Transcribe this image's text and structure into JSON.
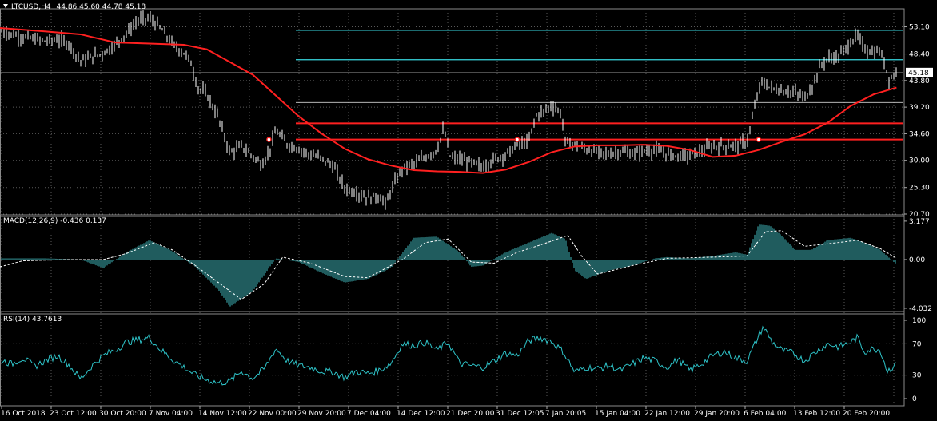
{
  "chart_data": {
    "type": "line",
    "symbol_title": "LTCUSD,H4",
    "ohlc_readout": "44.86 45.60 44.78 45.18",
    "current_price": 45.18,
    "x_ticks": [
      "16 Oct 2018",
      "23 Oct 12:00",
      "30 Oct 20:00",
      "7 Nov 04:00",
      "14 Nov 12:00",
      "22 Nov 00:00",
      "29 Nov 20:00",
      "7 Dec 04:00",
      "14 Dec 12:00",
      "21 Dec 20:00",
      "31 Dec 12:05",
      "7 Jan 20:05",
      "15 Jan 04:00",
      "22 Jan 12:00",
      "29 Jan 20:00",
      "6 Feb 04:00",
      "13 Feb 12:00",
      "20 Feb 20:00"
    ],
    "price_panel": {
      "y_ticks": [
        "53.10",
        "48.40",
        "43.80",
        "39.20",
        "34.60",
        "30.00",
        "25.30",
        "20.70"
      ],
      "ylim": [
        20.7,
        55.8
      ],
      "price_series": [
        {
          "x": 0,
          "y": 52.4
        },
        {
          "x": 0.5,
          "y": 51.8
        },
        {
          "x": 1,
          "y": 51.3
        },
        {
          "x": 1.5,
          "y": 51.0
        },
        {
          "x": 2,
          "y": 50.6
        },
        {
          "x": 2.5,
          "y": 50.9
        },
        {
          "x": 3,
          "y": 50.2
        },
        {
          "x": 3.5,
          "y": 47.2
        },
        {
          "x": 4,
          "y": 47.9
        },
        {
          "x": 4.5,
          "y": 48.6
        },
        {
          "x": 5,
          "y": 50.0
        },
        {
          "x": 5.5,
          "y": 52.0
        },
        {
          "x": 6,
          "y": 54.2
        },
        {
          "x": 6.5,
          "y": 54.6
        },
        {
          "x": 7,
          "y": 52.8
        },
        {
          "x": 7.5,
          "y": 50.1
        },
        {
          "x": 8,
          "y": 48.6
        },
        {
          "x": 8.3,
          "y": 47.0
        },
        {
          "x": 8.6,
          "y": 42.6
        },
        {
          "x": 9,
          "y": 41.4
        },
        {
          "x": 9.5,
          "y": 37.4
        },
        {
          "x": 10,
          "y": 31.3
        },
        {
          "x": 10.5,
          "y": 32.5
        },
        {
          "x": 11,
          "y": 30.7
        },
        {
          "x": 11.4,
          "y": 29.3
        },
        {
          "x": 11.7,
          "y": 31.4
        },
        {
          "x": 12,
          "y": 35.1
        },
        {
          "x": 12.5,
          "y": 32.8
        },
        {
          "x": 13,
          "y": 32.0
        },
        {
          "x": 13.5,
          "y": 31.0
        },
        {
          "x": 14,
          "y": 30.3
        },
        {
          "x": 14.5,
          "y": 29.0
        },
        {
          "x": 15,
          "y": 25.2
        },
        {
          "x": 15.5,
          "y": 24.4
        },
        {
          "x": 16,
          "y": 23.5
        },
        {
          "x": 16.5,
          "y": 23.8
        },
        {
          "x": 16.8,
          "y": 22.3
        },
        {
          "x": 17,
          "y": 24.8
        },
        {
          "x": 17.5,
          "y": 28.6
        },
        {
          "x": 18,
          "y": 29.4
        },
        {
          "x": 18.5,
          "y": 30.5
        },
        {
          "x": 19,
          "y": 31.8
        },
        {
          "x": 19.3,
          "y": 35.4
        },
        {
          "x": 19.6,
          "y": 30.5
        },
        {
          "x": 20,
          "y": 30.2
        },
        {
          "x": 20.5,
          "y": 29.6
        },
        {
          "x": 21,
          "y": 28.8
        },
        {
          "x": 21.5,
          "y": 30.2
        },
        {
          "x": 22,
          "y": 31.0
        },
        {
          "x": 22.5,
          "y": 32.6
        },
        {
          "x": 23,
          "y": 33.2
        },
        {
          "x": 23.3,
          "y": 37.7
        },
        {
          "x": 23.7,
          "y": 38.6
        },
        {
          "x": 24,
          "y": 39.6
        },
        {
          "x": 24.4,
          "y": 38.2
        },
        {
          "x": 24.6,
          "y": 33.1
        },
        {
          "x": 25,
          "y": 32.7
        },
        {
          "x": 25.5,
          "y": 31.9
        },
        {
          "x": 26,
          "y": 31.4
        },
        {
          "x": 26.5,
          "y": 31.1
        },
        {
          "x": 27,
          "y": 31.6
        },
        {
          "x": 27.5,
          "y": 31.1
        },
        {
          "x": 28,
          "y": 31.6
        },
        {
          "x": 28.5,
          "y": 31.8
        },
        {
          "x": 29,
          "y": 31.1
        },
        {
          "x": 29.5,
          "y": 30.8
        },
        {
          "x": 30,
          "y": 30.9
        },
        {
          "x": 30.5,
          "y": 31.6
        },
        {
          "x": 31,
          "y": 32.4
        },
        {
          "x": 31.5,
          "y": 32.5
        },
        {
          "x": 32,
          "y": 32.6
        },
        {
          "x": 32.5,
          "y": 33.2
        },
        {
          "x": 32.8,
          "y": 38.6
        },
        {
          "x": 33.1,
          "y": 43.6
        },
        {
          "x": 33.5,
          "y": 42.6
        },
        {
          "x": 34,
          "y": 42.0
        },
        {
          "x": 34.5,
          "y": 41.8
        },
        {
          "x": 35,
          "y": 40.8
        },
        {
          "x": 35.3,
          "y": 42.5
        },
        {
          "x": 35.7,
          "y": 46.5
        },
        {
          "x": 36,
          "y": 47.6
        },
        {
          "x": 36.5,
          "y": 48.0
        },
        {
          "x": 37,
          "y": 50.4
        },
        {
          "x": 37.3,
          "y": 51.6
        },
        {
          "x": 37.6,
          "y": 49.4
        },
        {
          "x": 38,
          "y": 48.6
        },
        {
          "x": 38.3,
          "y": 48.9
        },
        {
          "x": 38.7,
          "y": 44.0
        },
        {
          "x": 39,
          "y": 45.2
        }
      ],
      "moving_average": [
        {
          "x": 0,
          "y": 52.9
        },
        {
          "x": 2,
          "y": 52.3
        },
        {
          "x": 3.5,
          "y": 51.8
        },
        {
          "x": 5,
          "y": 50.4
        },
        {
          "x": 6.5,
          "y": 50.2
        },
        {
          "x": 8,
          "y": 50.0
        },
        {
          "x": 9,
          "y": 49.2
        },
        {
          "x": 10,
          "y": 47.0
        },
        {
          "x": 11,
          "y": 44.8
        },
        {
          "x": 12,
          "y": 41.2
        },
        {
          "x": 13,
          "y": 37.6
        },
        {
          "x": 14,
          "y": 34.6
        },
        {
          "x": 15,
          "y": 32.0
        },
        {
          "x": 16,
          "y": 30.2
        },
        {
          "x": 17,
          "y": 29.1
        },
        {
          "x": 18,
          "y": 28.3
        },
        {
          "x": 19,
          "y": 28.1
        },
        {
          "x": 20,
          "y": 28.0
        },
        {
          "x": 21,
          "y": 27.8
        },
        {
          "x": 22,
          "y": 28.4
        },
        {
          "x": 23,
          "y": 29.7
        },
        {
          "x": 24,
          "y": 31.4
        },
        {
          "x": 25,
          "y": 32.4
        },
        {
          "x": 26,
          "y": 32.6
        },
        {
          "x": 27,
          "y": 32.6
        },
        {
          "x": 28,
          "y": 32.7
        },
        {
          "x": 29,
          "y": 32.5
        },
        {
          "x": 30,
          "y": 31.8
        },
        {
          "x": 31,
          "y": 30.6
        },
        {
          "x": 32,
          "y": 30.8
        },
        {
          "x": 33,
          "y": 31.8
        },
        {
          "x": 34,
          "y": 33.2
        },
        {
          "x": 35,
          "y": 34.5
        },
        {
          "x": 36,
          "y": 36.5
        },
        {
          "x": 37,
          "y": 39.4
        },
        {
          "x": 38,
          "y": 41.4
        },
        {
          "x": 39,
          "y": 42.6
        }
      ],
      "cyan_levels": [
        52.5,
        47.4
      ],
      "white_levels": [
        40.0
      ],
      "red_levels": [
        36.4,
        33.6
      ],
      "red_markers": [
        {
          "x": 11.7,
          "y": 33.6
        },
        {
          "x": 22.5,
          "y": 33.6
        },
        {
          "x": 33.0,
          "y": 33.6
        }
      ],
      "colors": {
        "price": "#ffffff",
        "moving_average": "#ff2020",
        "cyan_level": "#38d8e0",
        "red_level": "#ff2020"
      }
    },
    "macd_panel": {
      "title": "MACD(12,26,9) -0.436 0.137",
      "y_ticks": [
        "3.177",
        "0.00",
        "-4.032"
      ],
      "ylim": [
        -4.3,
        3.5
      ],
      "histogram": [
        {
          "x": 0,
          "y": 0.1
        },
        {
          "x": 2,
          "y": 0.1
        },
        {
          "x": 3.5,
          "y": 0.0
        },
        {
          "x": 4.5,
          "y": -0.7
        },
        {
          "x": 5.5,
          "y": 0.6
        },
        {
          "x": 6.5,
          "y": 1.6
        },
        {
          "x": 7.5,
          "y": 0.7
        },
        {
          "x": 8.5,
          "y": -0.6
        },
        {
          "x": 9.5,
          "y": -2.5
        },
        {
          "x": 10,
          "y": -3.9
        },
        {
          "x": 11,
          "y": -2.6
        },
        {
          "x": 12,
          "y": 0.1
        },
        {
          "x": 13,
          "y": -0.2
        },
        {
          "x": 14,
          "y": -1.1
        },
        {
          "x": 15,
          "y": -1.9
        },
        {
          "x": 16,
          "y": -1.6
        },
        {
          "x": 17,
          "y": -0.7
        },
        {
          "x": 18,
          "y": 1.8
        },
        {
          "x": 19,
          "y": 1.9
        },
        {
          "x": 20,
          "y": 0.6
        },
        {
          "x": 20.5,
          "y": -0.6
        },
        {
          "x": 21,
          "y": -0.5
        },
        {
          "x": 22,
          "y": 0.6
        },
        {
          "x": 23,
          "y": 1.4
        },
        {
          "x": 24,
          "y": 2.2
        },
        {
          "x": 24.6,
          "y": 1.7
        },
        {
          "x": 25,
          "y": -0.9
        },
        {
          "x": 25.5,
          "y": -1.6
        },
        {
          "x": 26.5,
          "y": -0.9
        },
        {
          "x": 27.5,
          "y": -0.5
        },
        {
          "x": 28.5,
          "y": 0.1
        },
        {
          "x": 29,
          "y": 0.2
        },
        {
          "x": 30,
          "y": 0.1
        },
        {
          "x": 31,
          "y": 0.3
        },
        {
          "x": 32,
          "y": 0.6
        },
        {
          "x": 32.5,
          "y": 0.4
        },
        {
          "x": 33,
          "y": 2.9
        },
        {
          "x": 33.5,
          "y": 2.8
        },
        {
          "x": 34,
          "y": 2.0
        },
        {
          "x": 34.6,
          "y": 0.8
        },
        {
          "x": 35.3,
          "y": 0.8
        },
        {
          "x": 36,
          "y": 1.6
        },
        {
          "x": 37,
          "y": 1.8
        },
        {
          "x": 37.6,
          "y": 1.4
        },
        {
          "x": 38.3,
          "y": 0.8
        },
        {
          "x": 39,
          "y": -0.4
        }
      ],
      "signal": [
        {
          "x": 0,
          "y": -0.6
        },
        {
          "x": 1,
          "y": -0.1
        },
        {
          "x": 3,
          "y": 0.0
        },
        {
          "x": 4.5,
          "y": 0.0
        },
        {
          "x": 5.5,
          "y": 0.5
        },
        {
          "x": 6.7,
          "y": 1.4
        },
        {
          "x": 7.5,
          "y": 0.8
        },
        {
          "x": 8.5,
          "y": -0.5
        },
        {
          "x": 9.5,
          "y": -1.9
        },
        {
          "x": 10.5,
          "y": -3.3
        },
        {
          "x": 11.5,
          "y": -2.0
        },
        {
          "x": 12.3,
          "y": 0.2
        },
        {
          "x": 13.5,
          "y": -0.3
        },
        {
          "x": 15,
          "y": -1.4
        },
        {
          "x": 16,
          "y": -1.5
        },
        {
          "x": 17.5,
          "y": 0.0
        },
        {
          "x": 18.5,
          "y": 1.4
        },
        {
          "x": 19.5,
          "y": 1.7
        },
        {
          "x": 20.5,
          "y": -0.2
        },
        {
          "x": 21.5,
          "y": -0.3
        },
        {
          "x": 22.5,
          "y": 0.6
        },
        {
          "x": 23.5,
          "y": 1.2
        },
        {
          "x": 24.7,
          "y": 2.0
        },
        {
          "x": 25.3,
          "y": 0.3
        },
        {
          "x": 26,
          "y": -1.2
        },
        {
          "x": 27.5,
          "y": -0.5
        },
        {
          "x": 29,
          "y": 0.1
        },
        {
          "x": 31,
          "y": 0.2
        },
        {
          "x": 32.5,
          "y": 0.3
        },
        {
          "x": 33.3,
          "y": 2.3
        },
        {
          "x": 34,
          "y": 2.4
        },
        {
          "x": 35,
          "y": 1.1
        },
        {
          "x": 36,
          "y": 1.3
        },
        {
          "x": 37.3,
          "y": 1.6
        },
        {
          "x": 38.3,
          "y": 0.9
        },
        {
          "x": 39,
          "y": 0.1
        }
      ]
    },
    "rsi_panel": {
      "title": "RSI(14) 43.7613",
      "y_ticks": [
        "100",
        "70",
        "30",
        "0"
      ],
      "ylim": [
        0,
        100
      ],
      "levels": [
        70,
        30
      ],
      "series": [
        {
          "x": 0,
          "y": 50
        },
        {
          "x": 0.5,
          "y": 44
        },
        {
          "x": 1,
          "y": 52
        },
        {
          "x": 1.5,
          "y": 41
        },
        {
          "x": 2,
          "y": 49
        },
        {
          "x": 2.5,
          "y": 55
        },
        {
          "x": 3,
          "y": 43
        },
        {
          "x": 3.5,
          "y": 25
        },
        {
          "x": 4,
          "y": 42
        },
        {
          "x": 4.5,
          "y": 55
        },
        {
          "x": 5,
          "y": 62
        },
        {
          "x": 5.5,
          "y": 72
        },
        {
          "x": 6,
          "y": 75
        },
        {
          "x": 6.5,
          "y": 78
        },
        {
          "x": 7,
          "y": 62
        },
        {
          "x": 7.5,
          "y": 50
        },
        {
          "x": 8,
          "y": 40
        },
        {
          "x": 8.5,
          "y": 30
        },
        {
          "x": 9,
          "y": 24
        },
        {
          "x": 9.5,
          "y": 20
        },
        {
          "x": 10,
          "y": 22
        },
        {
          "x": 10.5,
          "y": 35
        },
        {
          "x": 11,
          "y": 26
        },
        {
          "x": 11.5,
          "y": 38
        },
        {
          "x": 12,
          "y": 64
        },
        {
          "x": 12.5,
          "y": 48
        },
        {
          "x": 13,
          "y": 42
        },
        {
          "x": 13.5,
          "y": 40
        },
        {
          "x": 14,
          "y": 35
        },
        {
          "x": 14.5,
          "y": 34
        },
        {
          "x": 15,
          "y": 27
        },
        {
          "x": 15.5,
          "y": 35
        },
        {
          "x": 16,
          "y": 32
        },
        {
          "x": 16.5,
          "y": 36
        },
        {
          "x": 17,
          "y": 45
        },
        {
          "x": 17.5,
          "y": 70
        },
        {
          "x": 18,
          "y": 68
        },
        {
          "x": 18.5,
          "y": 72
        },
        {
          "x": 19,
          "y": 62
        },
        {
          "x": 19.5,
          "y": 72
        },
        {
          "x": 20,
          "y": 45
        },
        {
          "x": 20.5,
          "y": 42
        },
        {
          "x": 21,
          "y": 40
        },
        {
          "x": 21.5,
          "y": 48
        },
        {
          "x": 22,
          "y": 58
        },
        {
          "x": 22.5,
          "y": 55
        },
        {
          "x": 23,
          "y": 74
        },
        {
          "x": 23.5,
          "y": 78
        },
        {
          "x": 24,
          "y": 73
        },
        {
          "x": 24.5,
          "y": 60
        },
        {
          "x": 25,
          "y": 34
        },
        {
          "x": 25.5,
          "y": 40
        },
        {
          "x": 26,
          "y": 38
        },
        {
          "x": 26.5,
          "y": 42
        },
        {
          "x": 27,
          "y": 36
        },
        {
          "x": 27.5,
          "y": 44
        },
        {
          "x": 28,
          "y": 52
        },
        {
          "x": 28.5,
          "y": 48
        },
        {
          "x": 29,
          "y": 40
        },
        {
          "x": 29.5,
          "y": 50
        },
        {
          "x": 30,
          "y": 36
        },
        {
          "x": 30.5,
          "y": 44
        },
        {
          "x": 31,
          "y": 55
        },
        {
          "x": 31.5,
          "y": 60
        },
        {
          "x": 32,
          "y": 52
        },
        {
          "x": 32.5,
          "y": 48
        },
        {
          "x": 33,
          "y": 80
        },
        {
          "x": 33.2,
          "y": 92
        },
        {
          "x": 33.6,
          "y": 72
        },
        {
          "x": 34,
          "y": 62
        },
        {
          "x": 34.5,
          "y": 58
        },
        {
          "x": 35,
          "y": 48
        },
        {
          "x": 35.5,
          "y": 60
        },
        {
          "x": 36,
          "y": 70
        },
        {
          "x": 36.5,
          "y": 66
        },
        {
          "x": 37,
          "y": 72
        },
        {
          "x": 37.3,
          "y": 78
        },
        {
          "x": 37.6,
          "y": 60
        },
        {
          "x": 38,
          "y": 64
        },
        {
          "x": 38.3,
          "y": 62
        },
        {
          "x": 38.6,
          "y": 35
        },
        {
          "x": 39,
          "y": 44
        }
      ],
      "color": "#2ec4c9"
    }
  }
}
